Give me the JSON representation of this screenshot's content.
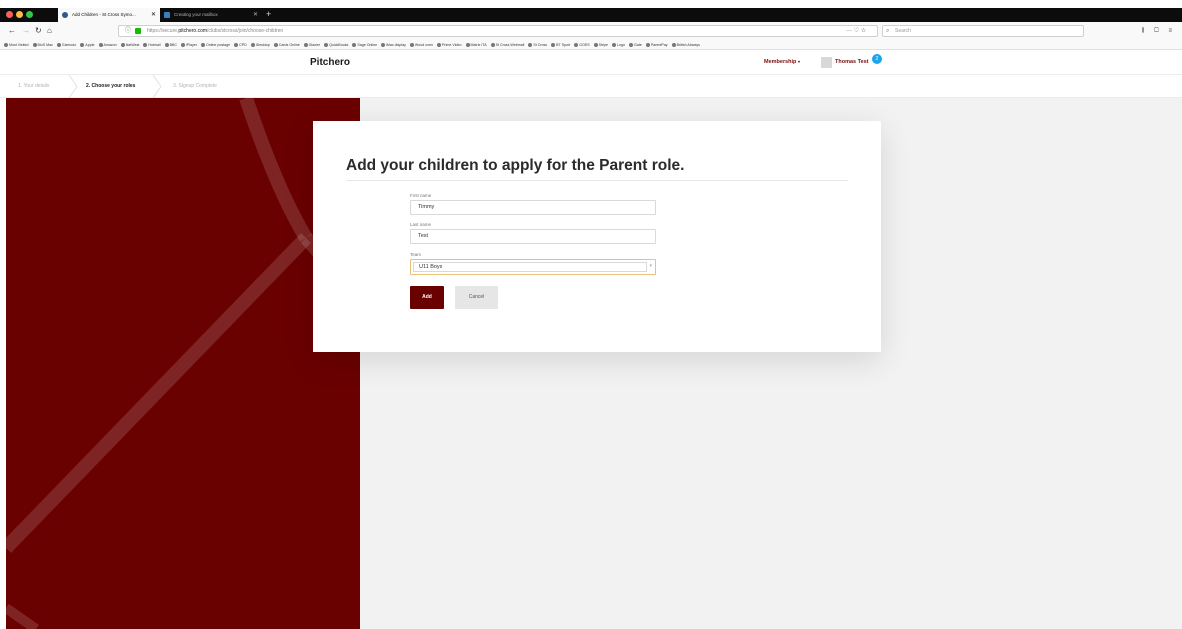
{
  "browser": {
    "tabs": [
      {
        "label": "Add Children - St Cross Symo...",
        "active": true
      },
      {
        "label": "Creating your mailbox",
        "active": false
      }
    ],
    "url_prefix": "https://secure.",
    "url_host": "pitchero.com",
    "url_path": "/clubs/stcross/join/choose-children",
    "search_placeholder": "Search",
    "bookmarks": [
      "Most Visited",
      "BloS Mac",
      "Gizmodo",
      "Apple",
      "Amazon",
      "NatWest",
      "Hotmail",
      "BBC",
      "iPlayer",
      "Online postage",
      "CPD",
      "iDesktop",
      "Cards Online",
      "Glacier",
      "QuickBooks",
      "Sage Online",
      "iMac display",
      "Wood oven",
      "Prime Video",
      "Matrix ITA",
      "St Cross Webmail",
      "St Cross",
      "BT Sport",
      "GOES",
      "Stripe",
      "Logo",
      "Gate",
      "ParentPay",
      "British Airways"
    ]
  },
  "header": {
    "logo": "Pitchero",
    "membership": "Membership",
    "user_name": "Thomas Test",
    "notifications": "2"
  },
  "steps": [
    {
      "label": "1. Your details"
    },
    {
      "label": "2. Choose your roles"
    },
    {
      "label": "3. Signup Complete"
    }
  ],
  "form": {
    "title": "Add your children to apply for the Parent role.",
    "first_name_label": "First name",
    "first_name_value": "Timmy",
    "last_name_label": "Last name",
    "last_name_value": "Test",
    "team_label": "Team",
    "team_value": "U11 Boys",
    "add_label": "Add",
    "cancel_label": "Cancel"
  },
  "colors": {
    "brand": "#6a0101",
    "accent_text": "#7a0e0e",
    "badge": "#1aa6ef"
  }
}
